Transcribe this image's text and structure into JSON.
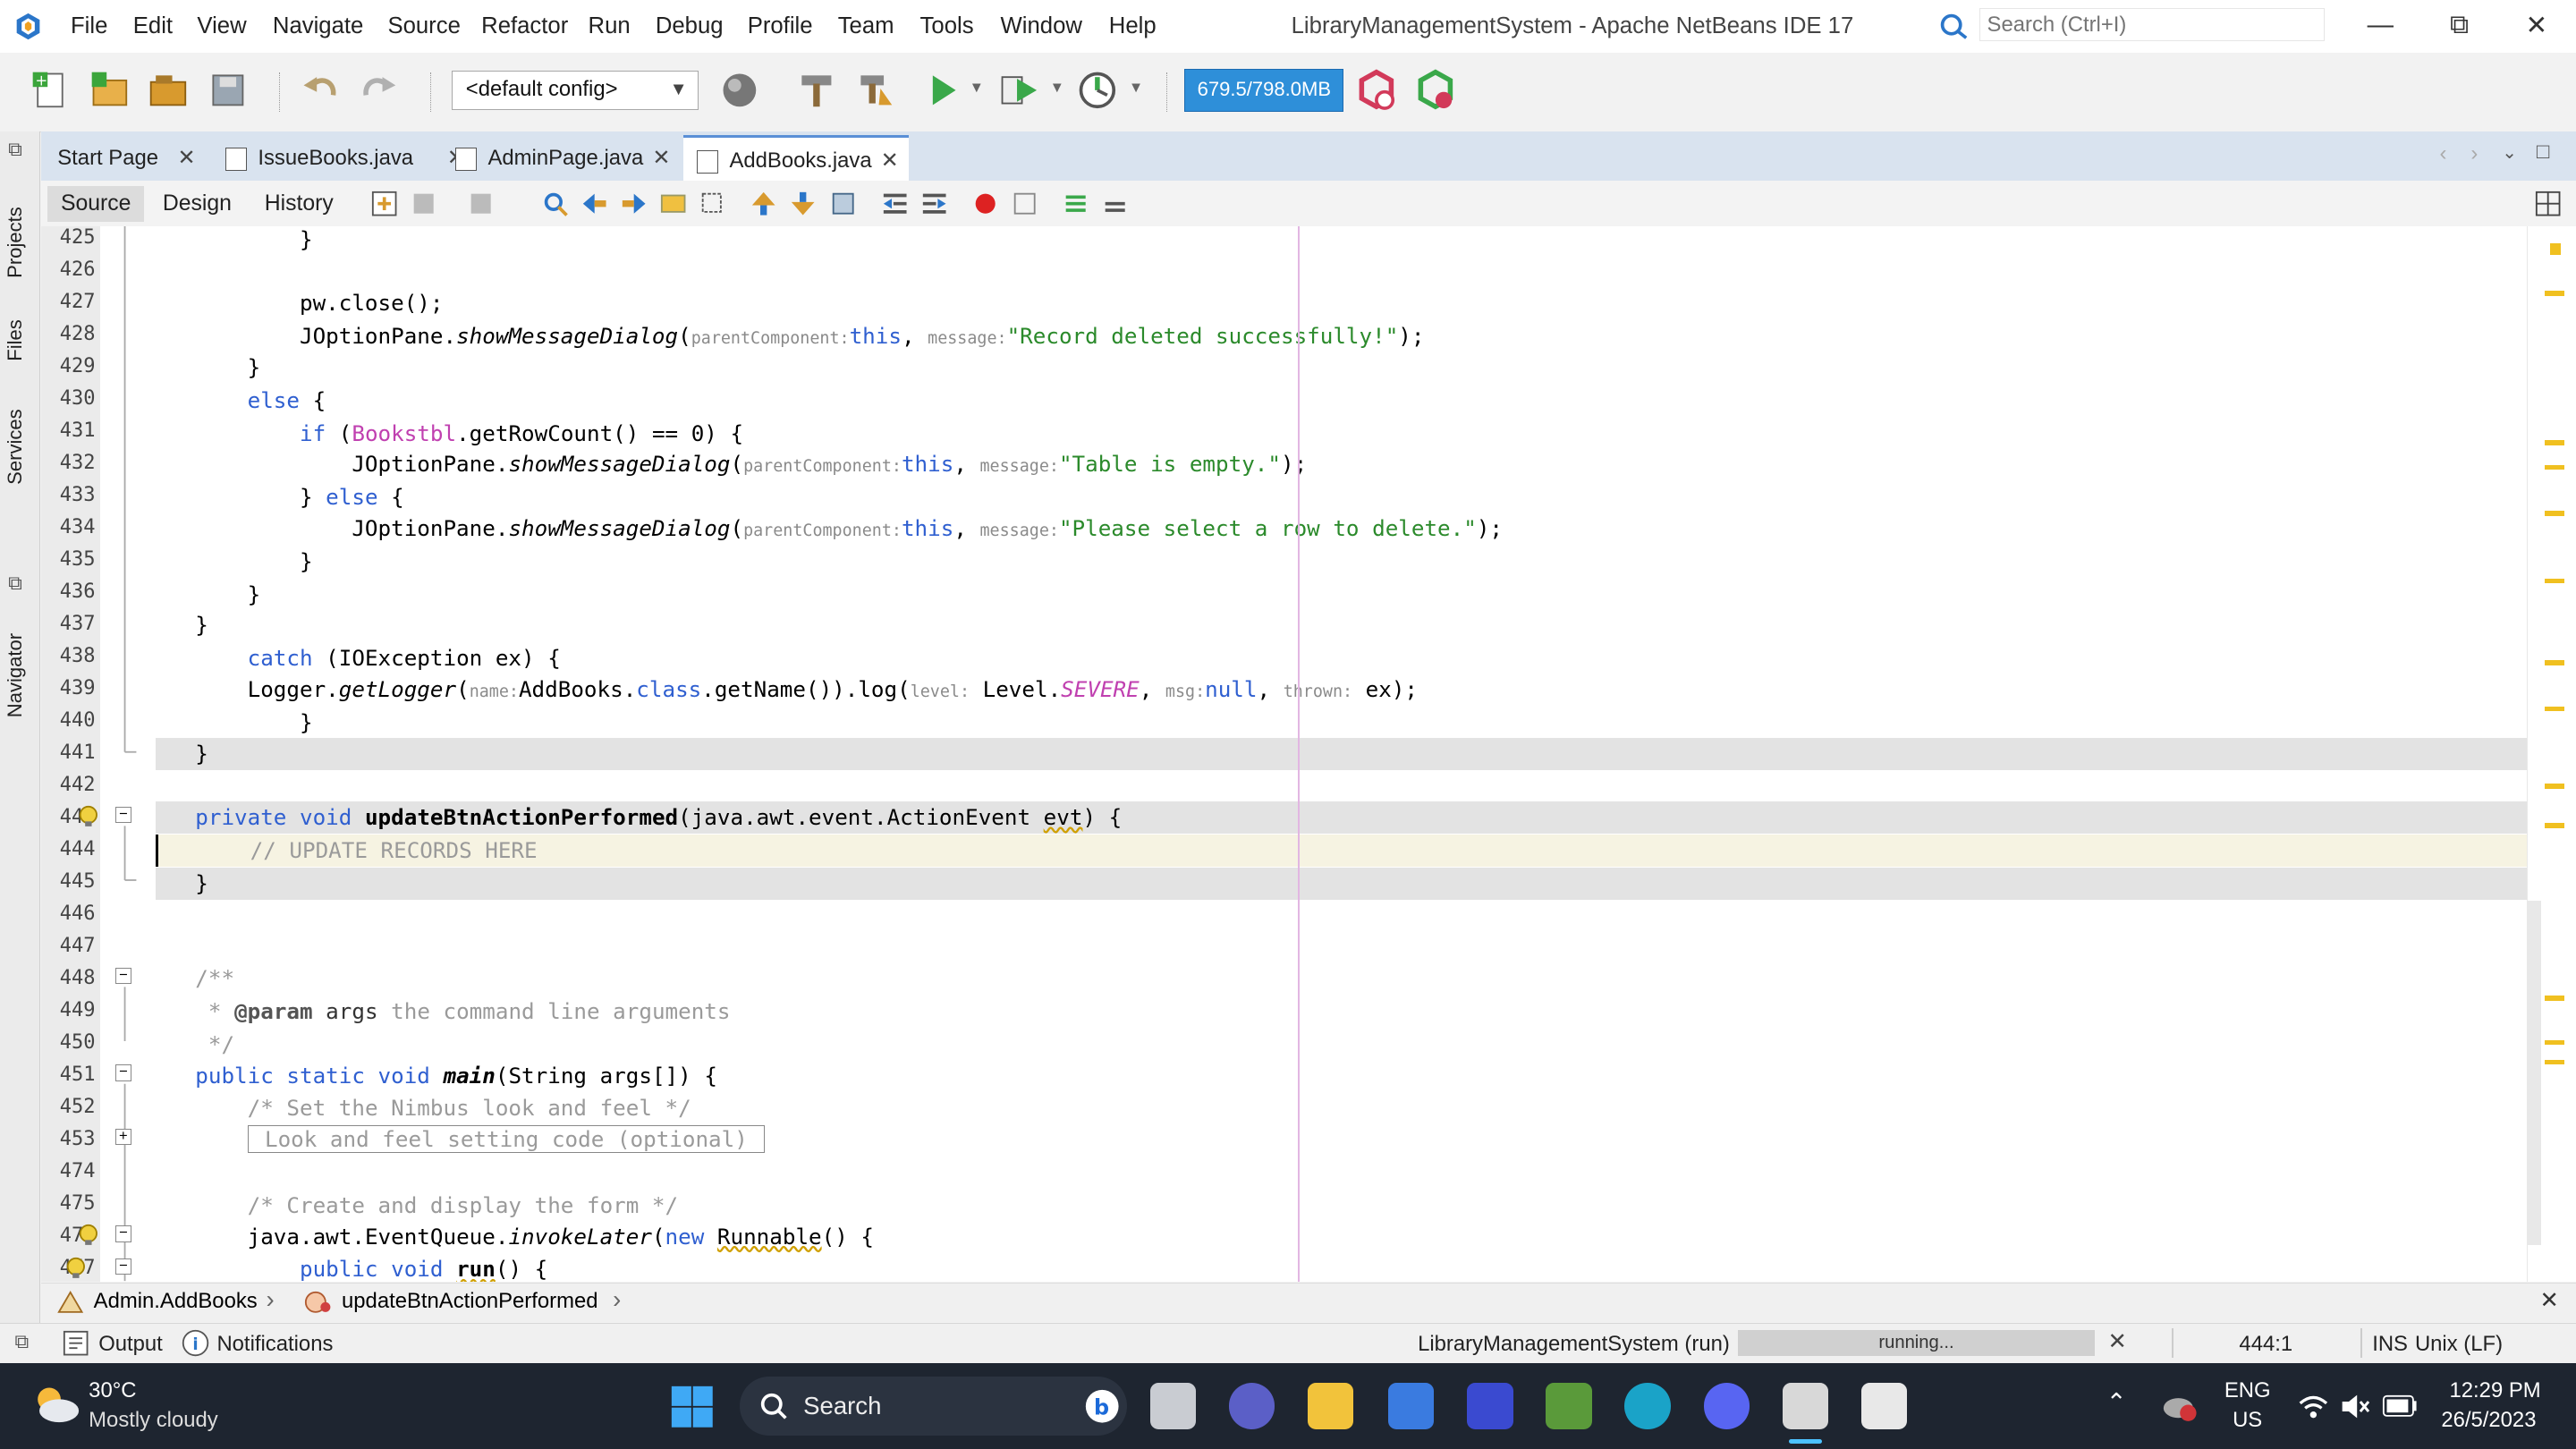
{
  "window": {
    "title": "LibraryManagementSystem - Apache NetBeans IDE 17",
    "menu": [
      "File",
      "Edit",
      "View",
      "Navigate",
      "Source",
      "Refactor",
      "Run",
      "Debug",
      "Profile",
      "Team",
      "Tools",
      "Window",
      "Help"
    ],
    "search_placeholder": "Search (Ctrl+I)"
  },
  "toolbar": {
    "config": "<default config>",
    "memory": "679.5/798.0MB"
  },
  "side_panels": {
    "projects": "Projects",
    "files": "Files",
    "services": "Services",
    "navigator": "Navigator"
  },
  "tabs": [
    {
      "label": "Start Page"
    },
    {
      "label": "IssueBooks.java"
    },
    {
      "label": "AdminPage.java"
    },
    {
      "label": "AddBooks.java",
      "active": true
    }
  ],
  "editor_tabs": [
    "Source",
    "Design",
    "History"
  ],
  "line_numbers": [
    "425",
    "426",
    "427",
    "428",
    "429",
    "430",
    "431",
    "432",
    "433",
    "434",
    "435",
    "436",
    "437",
    "438",
    "439",
    "440",
    "441",
    "442",
    "443",
    "444",
    "445",
    "446",
    "447",
    "448",
    "449",
    "450",
    "451",
    "452",
    "453",
    "474",
    "475",
    "476",
    "477"
  ],
  "code": {
    "l427": "pw.close();",
    "l428_a": "JOptionPane.",
    "l428_m": "showMessageDialog",
    "l428_h1": "parentComponent:",
    "l428_h2": "message:",
    "l428_s": "\"Record deleted successfully!\"",
    "l430": "else",
    "l431_if": "if",
    "l431_v": "Bookstbl",
    "l431_r": ".getRowCount() == 0) {",
    "l432_s": "\"Table is empty.\"",
    "l434_s": "\"Please select a row to delete.\"",
    "l438_k": "catch",
    "l438_r": "(IOException ex) {",
    "l439_a": "Logger.",
    "l439_m": "getLogger",
    "l439_h1": "name:",
    "l439_b": "AddBooks.",
    "l439_cls": "class",
    "l439_c": ".getName()).log(",
    "l439_h2": "level:",
    "l439_d": "Level.",
    "l439_f": "SEVERE",
    "l439_h3": "msg:",
    "l439_null": "null",
    "l439_h4": "thrown:",
    "l439_e": "ex);",
    "l443_k": "private void",
    "l443_m": "updateBtnActionPerformed",
    "l443_r": "(java.awt.event.ActionEvent",
    "l443_u": "evt",
    "l443_e": ") {",
    "l444": "// UPDATE RECORDS HERE",
    "l448": "/**",
    "l449_a": " * ",
    "l449_p": "@param",
    "l449_b": " args",
    "l449_c": " the command line arguments",
    "l450": " */",
    "l451_k": "public static void",
    "l451_m": "main",
    "l451_r": "(String args[]) {",
    "l452": "/* Set the Nimbus look and feel */",
    "l453": "Look and feel setting code (optional)",
    "l475": "/* Create and display the form */",
    "l476_a": "java.awt.EventQueue.",
    "l476_m": "invokeLater",
    "l476_new": "new",
    "l476_u": "Runnable",
    "l476_e": "() {",
    "l477_k": "public void",
    "l477_m": "run",
    "l477_e": "() {"
  },
  "breadcrumb": [
    "Admin.AddBooks",
    "updateBtnActionPerformed"
  ],
  "status": {
    "output": "Output",
    "notifications": "Notifications",
    "run_label": "LibraryManagementSystem (run)",
    "progress": "running...",
    "position": "444:1",
    "mode": "INS",
    "eol": "Unix (LF)"
  },
  "taskbar": {
    "temp": "30°C",
    "weather": "Mostly cloudy",
    "search": "Search",
    "lang": "ENG",
    "region": "US",
    "time": "12:29 PM",
    "date": "26/5/2023"
  }
}
